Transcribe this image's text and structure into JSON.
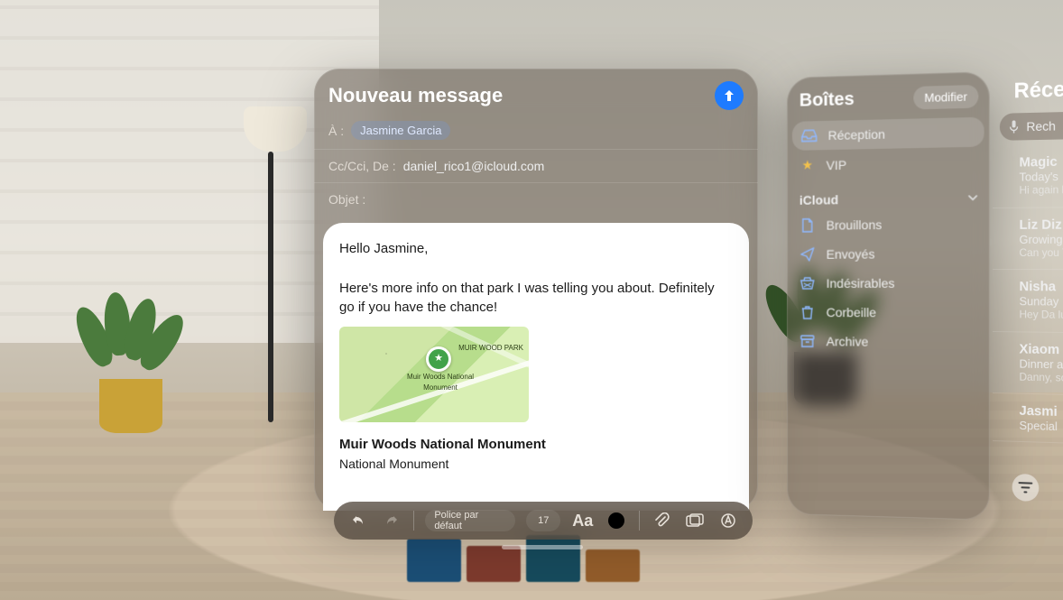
{
  "compose": {
    "title": "Nouveau message",
    "to_label": "À :",
    "to_chip": "Jasmine Garcia",
    "cc_label": "Cc/Cci, De :",
    "from_address": "daniel_rico1@icloud.com",
    "subject_label": "Objet :",
    "subject_value": "",
    "greeting": "Hello Jasmine,",
    "paragraph": "Here's more info on that park I was telling you about. Definitely go if you have the chance!",
    "map_label": "Muir Woods National Monument",
    "map_park": "MUIR WOOD PARK",
    "attachment_title": "Muir Woods National Monument",
    "attachment_subtitle": "National Monument"
  },
  "toolbar": {
    "font_label": "Police par défaut",
    "font_size": "17",
    "text_color": "#000000"
  },
  "mailboxes": {
    "title": "Boîtes",
    "edit": "Modifier",
    "top": [
      {
        "icon": "inbox",
        "label": "Réception",
        "selected": true
      },
      {
        "icon": "star",
        "label": "VIP"
      }
    ],
    "account": "iCloud",
    "folders": [
      {
        "icon": "doc",
        "label": "Brouillons"
      },
      {
        "icon": "sent",
        "label": "Envoyés"
      },
      {
        "icon": "junk",
        "label": "Indésirables"
      },
      {
        "icon": "trash",
        "label": "Corbeille"
      },
      {
        "icon": "box",
        "label": "Archive"
      }
    ]
  },
  "inbox": {
    "title": "Réce",
    "search_placeholder": "Rech",
    "messages": [
      {
        "from": "Magic",
        "subject": "Today's",
        "preview": "Hi again\nbreathta"
      },
      {
        "from": "Liz Diz",
        "subject": "Growing",
        "preview": "Can you\nThanks"
      },
      {
        "from": "Nisha",
        "subject": "Sunday",
        "preview": "Hey Da\nlunch o"
      },
      {
        "from": "Xiaom",
        "subject": "Dinner a",
        "preview": "Danny,\nso muc"
      },
      {
        "from": "Jasmi",
        "subject": "Special",
        "preview": ""
      }
    ]
  }
}
